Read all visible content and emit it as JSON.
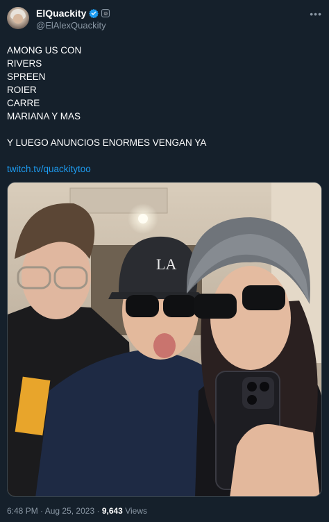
{
  "tweet": {
    "author": {
      "display_name": "ElQuackity",
      "handle": "@ElAlexQuackity",
      "badge_icon": "verified-badge-icon",
      "verified_color": "#1d9bf0",
      "affiliate_icon": "emoji-face-icon"
    },
    "more_icon": "more-options-icon",
    "lines": [
      "AMONG US CON",
      "RIVERS",
      "SPREEN",
      "ROIER",
      "CARRE",
      "MARIANA Y MAS",
      "",
      "Y LUEGO ANUNCIOS ENORMES VENGAN YA",
      ""
    ],
    "link": "twitch.tv/quackitytoo",
    "photo_logo": "LA",
    "meta": {
      "time": "6:48 PM",
      "separator": "·",
      "date": "Aug 25, 2023",
      "views": "9,643",
      "views_label": "Views"
    }
  },
  "colors": {
    "background": "#15202b",
    "text": "#ffffff",
    "secondary": "#8b98a5",
    "link": "#1d9bf0",
    "border": "#38444d"
  }
}
